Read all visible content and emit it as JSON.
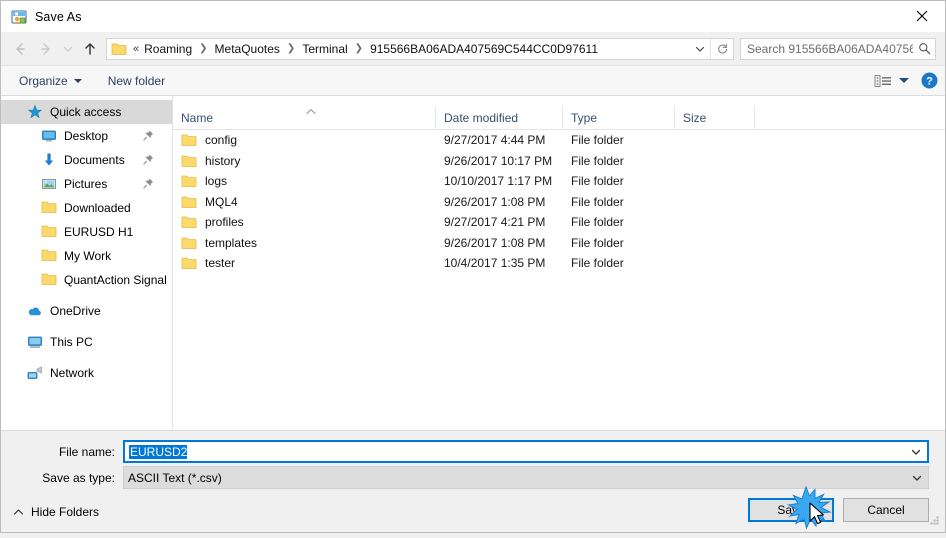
{
  "window": {
    "title": "Save As",
    "icon": "save-as-icon",
    "close_label": "✕"
  },
  "nav": {
    "back_icon": "arrow-left-icon",
    "forward_icon": "arrow-right-icon",
    "recent_icon": "chevron-down-icon",
    "up_icon": "arrow-up-icon",
    "address": {
      "folder_icon": "folder-icon",
      "prefix": "«",
      "crumbs": [
        "Roaming",
        "MetaQuotes",
        "Terminal",
        "915566BA06ADA407569C544CC0D97611"
      ],
      "dropdown_icon": "chevron-down-icon",
      "refresh_icon": "refresh-icon"
    },
    "search": {
      "placeholder": "Search 915566BA06ADA40756...",
      "icon": "search-icon"
    }
  },
  "toolbar": {
    "organize_label": "Organize",
    "new_folder_label": "New folder",
    "view_icon": "list-view-icon",
    "view_caret_icon": "chevron-down-icon",
    "help_icon": "help-icon",
    "help_label": "?"
  },
  "sidebar": {
    "items": [
      {
        "label": "Quick access",
        "icon": "star-icon",
        "level": 0,
        "selected": true,
        "pinned": false
      },
      {
        "label": "Desktop",
        "icon": "desktop-icon",
        "level": 1,
        "selected": false,
        "pinned": true
      },
      {
        "label": "Documents",
        "icon": "documents-icon",
        "level": 1,
        "selected": false,
        "pinned": true
      },
      {
        "label": "Pictures",
        "icon": "pictures-icon",
        "level": 1,
        "selected": false,
        "pinned": true
      },
      {
        "label": "Downloaded",
        "icon": "folder-icon",
        "level": 1,
        "selected": false,
        "pinned": false
      },
      {
        "label": "EURUSD H1",
        "icon": "folder-icon",
        "level": 1,
        "selected": false,
        "pinned": false
      },
      {
        "label": "My Work",
        "icon": "folder-icon",
        "level": 1,
        "selected": false,
        "pinned": false
      },
      {
        "label": "QuantAction Signal",
        "icon": "folder-icon",
        "level": 1,
        "selected": false,
        "pinned": false
      },
      {
        "label": "OneDrive",
        "icon": "onedrive-icon",
        "level": 0,
        "selected": false,
        "pinned": false,
        "gap_before": true
      },
      {
        "label": "This PC",
        "icon": "thispc-icon",
        "level": 0,
        "selected": false,
        "pinned": false,
        "gap_before": true
      },
      {
        "label": "Network",
        "icon": "network-icon",
        "level": 0,
        "selected": false,
        "pinned": false,
        "gap_before": true
      }
    ]
  },
  "filelist": {
    "columns": [
      "Name",
      "Date modified",
      "Type",
      "Size"
    ],
    "sort_column": "Name",
    "sort_direction": "ascending",
    "rows": [
      {
        "name": "config",
        "date_modified": "9/27/2017 4:44 PM",
        "type": "File folder",
        "size": ""
      },
      {
        "name": "history",
        "date_modified": "9/26/2017 10:17 PM",
        "type": "File folder",
        "size": ""
      },
      {
        "name": "logs",
        "date_modified": "10/10/2017 1:17 PM",
        "type": "File folder",
        "size": ""
      },
      {
        "name": "MQL4",
        "date_modified": "9/26/2017 1:08 PM",
        "type": "File folder",
        "size": ""
      },
      {
        "name": "profiles",
        "date_modified": "9/27/2017 4:21 PM",
        "type": "File folder",
        "size": ""
      },
      {
        "name": "templates",
        "date_modified": "9/26/2017 1:08 PM",
        "type": "File folder",
        "size": ""
      },
      {
        "name": "tester",
        "date_modified": "10/4/2017 1:35 PM",
        "type": "File folder",
        "size": ""
      }
    ]
  },
  "form": {
    "filename_label": "File name:",
    "filename_value": "EURUSD2",
    "filename_selected": true,
    "filetype_label": "Save as type:",
    "filetype_value": "ASCII Text (*.csv)"
  },
  "footer": {
    "hide_folders_label": "Hide Folders",
    "hide_folders_icon": "chevron-up-icon",
    "save_label": "Save",
    "cancel_label": "Cancel",
    "default_button": "Save"
  },
  "colors": {
    "accent": "#0078d7",
    "folder_yellow": "#ffd966",
    "window_bg": "#f0f0f0",
    "selection": "#d9d9d9"
  }
}
